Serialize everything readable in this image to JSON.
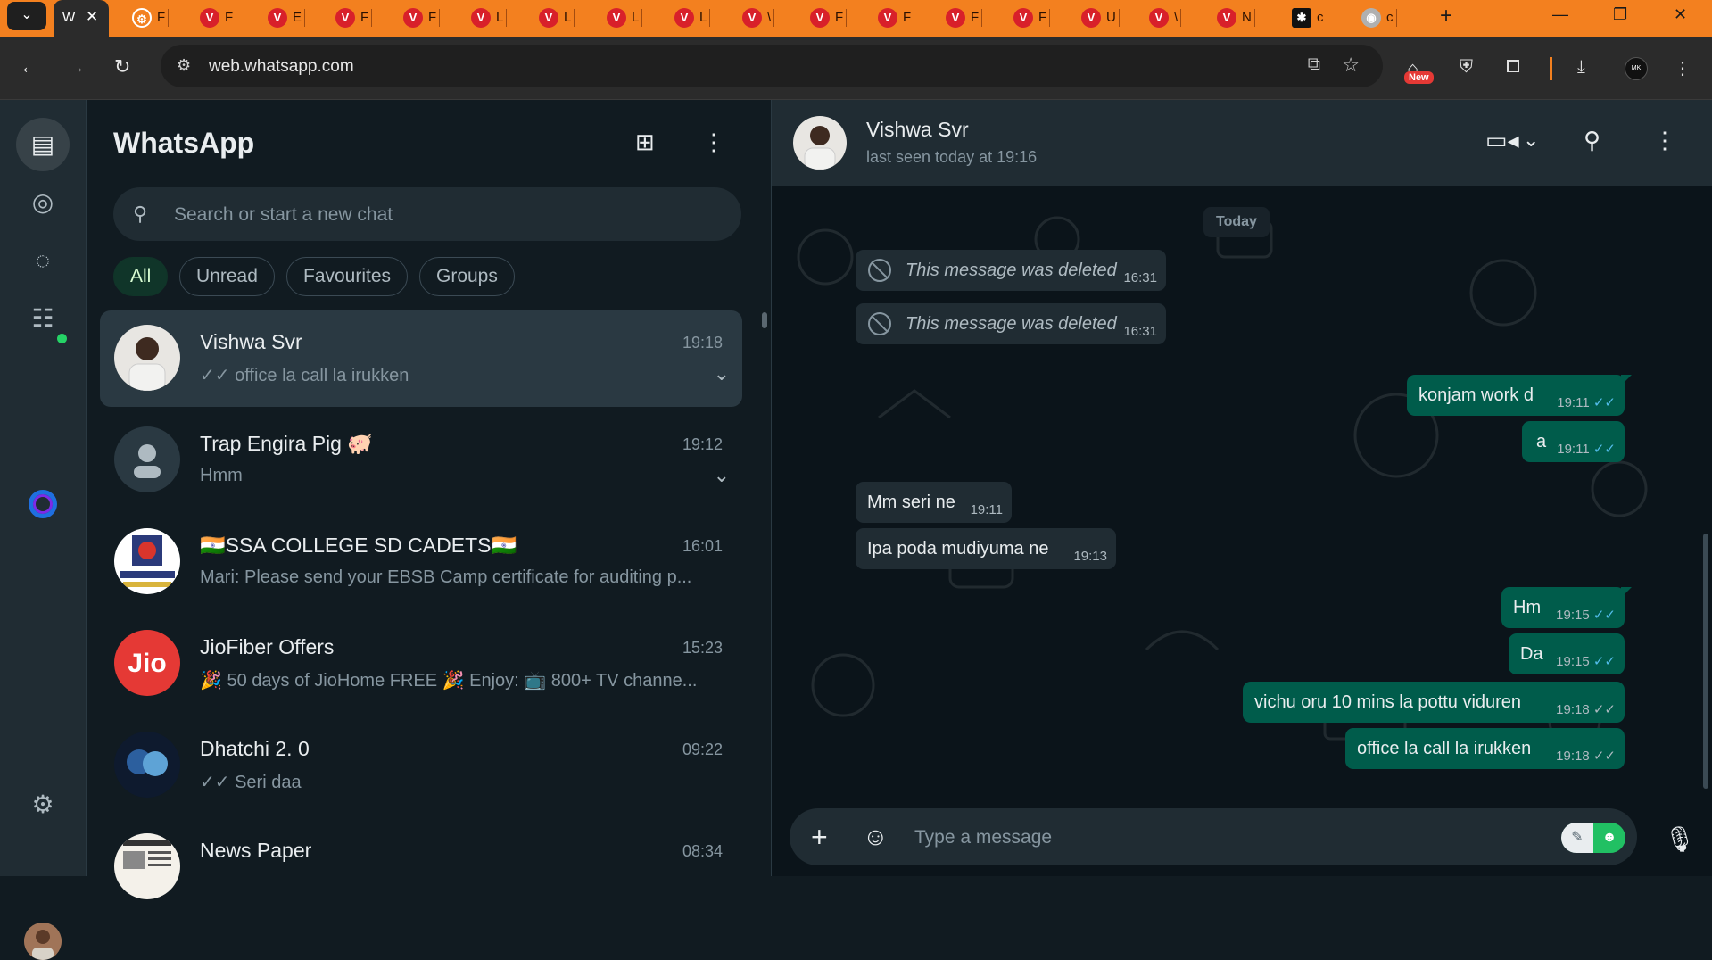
{
  "browser": {
    "tabs_dropdown": "⌄",
    "active_tab": {
      "label": "W",
      "close": "✕"
    },
    "tabs": [
      {
        "label": "F",
        "icon": "openai-icon"
      },
      {
        "label": "F",
        "icon": "v-icon"
      },
      {
        "label": "E",
        "icon": "v-icon"
      },
      {
        "label": "F",
        "icon": "v-icon"
      },
      {
        "label": "F",
        "icon": "v-icon"
      },
      {
        "label": "L",
        "icon": "v-icon"
      },
      {
        "label": "L",
        "icon": "v-icon"
      },
      {
        "label": "L",
        "icon": "v-icon"
      },
      {
        "label": "L",
        "icon": "v-icon"
      },
      {
        "label": "\\",
        "icon": "v-icon"
      },
      {
        "label": "F",
        "icon": "v-icon"
      },
      {
        "label": "F",
        "icon": "v-icon"
      },
      {
        "label": "F",
        "icon": "v-icon"
      },
      {
        "label": "F",
        "icon": "v-icon"
      },
      {
        "label": "U",
        "icon": "v-icon"
      },
      {
        "label": "\\",
        "icon": "v-icon"
      },
      {
        "label": "N",
        "icon": "v-icon"
      },
      {
        "label": "c",
        "icon": "ai-icon"
      },
      {
        "label": "c",
        "icon": "chrome-icon"
      }
    ],
    "url": "web.whatsapp.com",
    "new_badge": "New",
    "accent": "#f3801f"
  },
  "whatsapp": {
    "title": "WhatsApp",
    "search_placeholder": "Search or start a new chat",
    "filters": [
      "All",
      "Unread",
      "Favourites",
      "Groups"
    ],
    "chats": [
      {
        "name": "Vishwa Svr",
        "time": "19:18",
        "preview": "✓✓ office la call la irukken",
        "selected": true
      },
      {
        "name": "Trap Engira Pig 🐖",
        "time": "19:12",
        "preview": "Hmm",
        "selected": false
      },
      {
        "name": "🇮🇳SSA COLLEGE SD CADETS🇮🇳",
        "time": "16:01",
        "preview": "Mari: Please send your EBSB Camp certificate for auditing p...",
        "selected": false
      },
      {
        "name": "JioFiber Offers",
        "time": "15:23",
        "preview": "🎉 50 days of JioHome FREE 🎉 Enjoy: 📺 800+ TV channe...",
        "selected": false
      },
      {
        "name": "Dhatchi 2. 0",
        "time": "09:22",
        "preview": "✓✓ Seri daa",
        "selected": false
      },
      {
        "name": "News Paper",
        "time": "08:34",
        "preview": "",
        "selected": false
      }
    ],
    "conversation": {
      "name": "Vishwa Svr",
      "status": "last seen today at 19:16",
      "day": "Today",
      "composer_placeholder": "Type a message",
      "messages": [
        {
          "dir": "in",
          "deleted": true,
          "text": "This message was deleted",
          "time": "16:31"
        },
        {
          "dir": "in",
          "deleted": true,
          "text": "This message was deleted",
          "time": "16:31"
        },
        {
          "dir": "out",
          "text": "konjam work d",
          "time": "19:11",
          "ticks": "✓✓",
          "read": true
        },
        {
          "dir": "out",
          "text": "a",
          "time": "19:11",
          "ticks": "✓✓",
          "read": true
        },
        {
          "dir": "in",
          "text": "Mm seri ne",
          "time": "19:11"
        },
        {
          "dir": "in",
          "text": "Ipa poda mudiyuma ne",
          "time": "19:13"
        },
        {
          "dir": "out",
          "text": "Hm",
          "time": "19:15",
          "ticks": "✓✓",
          "read": true
        },
        {
          "dir": "out",
          "text": "Da",
          "time": "19:15",
          "ticks": "✓✓",
          "read": true
        },
        {
          "dir": "out",
          "text": "vichu oru 10 mins la pottu viduren",
          "time": "19:18",
          "ticks": "✓✓",
          "read": false
        },
        {
          "dir": "out",
          "text": "office la call la irukken",
          "time": "19:18",
          "ticks": "✓✓",
          "read": false
        }
      ]
    }
  }
}
